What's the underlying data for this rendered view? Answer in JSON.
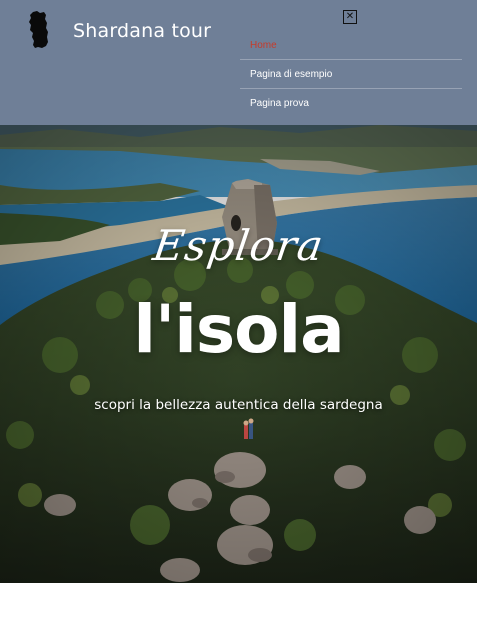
{
  "header": {
    "site_title": "Shardana tour",
    "close_icon": "close-icon",
    "logo_icon": "sardinia-island-icon"
  },
  "nav": {
    "items": [
      {
        "label": "Home",
        "active": true
      },
      {
        "label": "Pagina di esempio",
        "active": false
      },
      {
        "label": "Pagina prova",
        "active": false
      }
    ]
  },
  "hero": {
    "kicker": "Esplora",
    "title": "l'isola",
    "subtitle": "scopri la bellezza autentica della sardegna"
  },
  "colors": {
    "header_bg": "#6f7f97",
    "active_nav": "#c63b2a",
    "text_light": "#ffffff"
  }
}
